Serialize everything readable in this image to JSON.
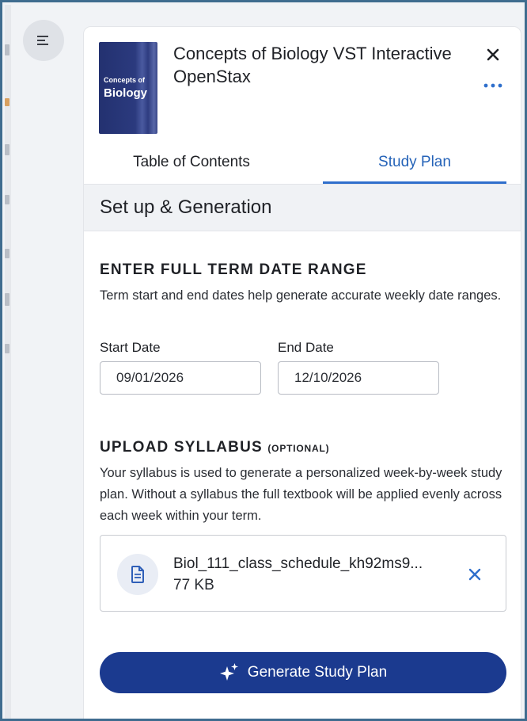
{
  "colors": {
    "accent": "#2563b8",
    "primary_button": "#1b3a8f",
    "frame_border": "#3f6c8f"
  },
  "nav": {
    "menu_icon": "hamburger-menu-icon"
  },
  "book": {
    "cover_small": "Concepts of",
    "cover_big": "Biology",
    "title": "Concepts of Biology VST Interactive OpenStax",
    "close_icon": "close-icon",
    "more_icon": "more-horizontal-icon"
  },
  "tabs": [
    {
      "label": "Table of Contents",
      "active": false
    },
    {
      "label": "Study Plan",
      "active": true
    }
  ],
  "setup": {
    "section_title": "Set up & Generation",
    "term": {
      "heading": "ENTER FULL TERM DATE RANGE",
      "description": "Term start and end dates help generate accurate weekly date ranges.",
      "start_label": "Start Date",
      "start_value": "09/01/2026",
      "end_label": "End Date",
      "end_value": "12/10/2026"
    },
    "syllabus": {
      "heading": "UPLOAD SYLLABUS",
      "optional": "(OPTIONAL)",
      "description": "Your syllabus is used to generate a personalized week-by-week study plan. Without a syllabus the full textbook will be applied evenly across each week within your term.",
      "file_icon": "document-icon",
      "file_name": "Biol_111_class_schedule_kh92ms9...",
      "file_size": "77 KB",
      "remove_icon": "close-icon"
    },
    "generate": {
      "icon": "sparkle-icon",
      "label": "Generate Study Plan"
    }
  }
}
